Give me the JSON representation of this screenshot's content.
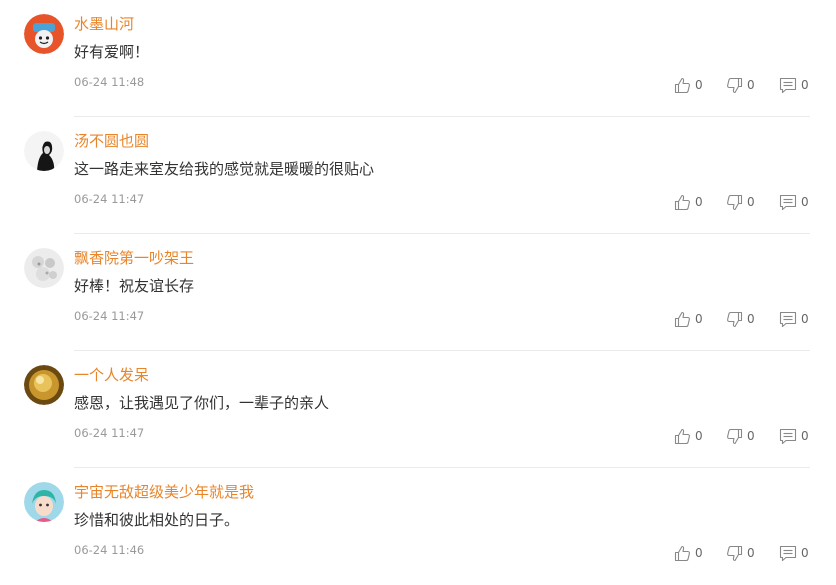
{
  "comments": [
    {
      "username": "水墨山河",
      "text": "好有爱啊！",
      "time": "06-24 11:48",
      "likes": "0",
      "dislikes": "0",
      "replies": "0"
    },
    {
      "username": "汤不圆也圆",
      "text": "这一路走来室友给我的感觉就是暖暖的很贴心",
      "time": "06-24 11:47",
      "likes": "0",
      "dislikes": "0",
      "replies": "0"
    },
    {
      "username": "飘香院第一吵架王",
      "text": "好棒！祝友谊长存",
      "time": "06-24 11:47",
      "likes": "0",
      "dislikes": "0",
      "replies": "0"
    },
    {
      "username": "一个人发呆",
      "text": "感恩，让我遇见了你们，一辈子的亲人",
      "time": "06-24 11:47",
      "likes": "0",
      "dislikes": "0",
      "replies": "0"
    },
    {
      "username": "宇宙无敌超级美少年就是我",
      "text": "珍惜和彼此相处的日子。",
      "time": "06-24 11:46",
      "likes": "0",
      "dislikes": "0",
      "replies": "0"
    }
  ],
  "icons": {
    "like": "thumbs-up-icon",
    "dislike": "thumbs-down-icon",
    "reply": "comment-icon"
  },
  "colors": {
    "username": "#e8852b",
    "text": "#333333",
    "time": "#999999",
    "divider": "#ebebeb",
    "icon": "#888888"
  }
}
